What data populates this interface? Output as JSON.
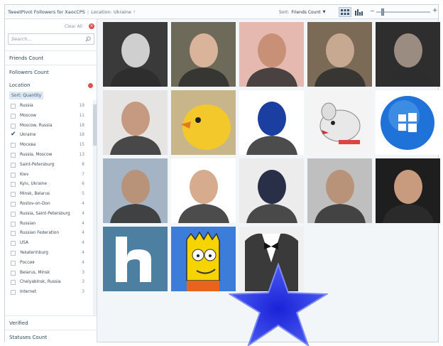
{
  "header": {
    "breadcrumb_app": "TweetPivot Followers for XaocCPS",
    "breadcrumb_location": "Location: Ukraine",
    "sort_label": "Sort:",
    "sort_value": "Friends Count",
    "zoom_minus": "−",
    "zoom_plus": "+"
  },
  "sidebar": {
    "clear_all": "Clear All",
    "search_placeholder": "Search...",
    "facets": {
      "friends_count": "Friends Count",
      "followers_count": "Followers Count",
      "location": "Location",
      "verified": "Verified",
      "statuses_count": "Statuses Count"
    },
    "location_sort": "Sort: Quantity",
    "locations": [
      {
        "label": "Russia",
        "count": "19",
        "checked": false
      },
      {
        "label": "Moscow",
        "count": "11",
        "checked": false
      },
      {
        "label": "Moscow, Russia",
        "count": "18",
        "checked": false
      },
      {
        "label": "Ukraine",
        "count": "18",
        "checked": true
      },
      {
        "label": "Москва",
        "count": "15",
        "checked": false
      },
      {
        "label": "Russia, Moscow",
        "count": "13",
        "checked": false
      },
      {
        "label": "Saint-Petersburg",
        "count": "8",
        "checked": false
      },
      {
        "label": "Kiev",
        "count": "7",
        "checked": false
      },
      {
        "label": "Kyiv, Ukraine",
        "count": "6",
        "checked": false
      },
      {
        "label": "Minsk, Belarus",
        "count": "5",
        "checked": false
      },
      {
        "label": "Rostov-on-Don",
        "count": "4",
        "checked": false
      },
      {
        "label": "Russia, Saint-Petersburg",
        "count": "4",
        "checked": false
      },
      {
        "label": "Russian",
        "count": "4",
        "checked": false
      },
      {
        "label": "Russian Federation",
        "count": "4",
        "checked": false
      },
      {
        "label": "USA",
        "count": "4",
        "checked": false
      },
      {
        "label": "Yekaterinburg",
        "count": "4",
        "checked": false
      },
      {
        "label": "Россия",
        "count": "4",
        "checked": false
      },
      {
        "label": "Belarus, Minsk",
        "count": "3",
        "checked": false
      },
      {
        "label": "Chelyabinsk, Russia",
        "count": "3",
        "checked": false
      },
      {
        "label": "Internet",
        "count": "3",
        "checked": false
      }
    ]
  },
  "avatars": [
    {
      "name": "gym-photo",
      "icon": "person"
    },
    {
      "name": "young-man",
      "icon": "person"
    },
    {
      "name": "man-pink-bg",
      "icon": "person"
    },
    {
      "name": "face-closeup",
      "icon": "person"
    },
    {
      "name": "bald-man-smoking",
      "icon": "person"
    },
    {
      "name": "man-short-hair",
      "icon": "person"
    },
    {
      "name": "yellow-chick",
      "icon": "bird"
    },
    {
      "name": "che-guevara",
      "icon": "person"
    },
    {
      "name": "cartoon-rat",
      "icon": "rat"
    },
    {
      "name": "windows-logo",
      "icon": "windows"
    },
    {
      "name": "man-sunglasses",
      "icon": "person"
    },
    {
      "name": "bald-man",
      "icon": "person"
    },
    {
      "name": "man-cap",
      "icon": "person"
    },
    {
      "name": "man-outdoors",
      "icon": "person"
    },
    {
      "name": "man-dark-bg",
      "icon": "person"
    },
    {
      "name": "letter-h",
      "icon": "h"
    },
    {
      "name": "bart-simpson",
      "icon": "bart"
    },
    {
      "name": "tuxedo",
      "icon": "tuxedo"
    }
  ],
  "colors": {
    "star": "#2b3fe0",
    "accent": "#2b4a63",
    "clear": "#e05050"
  }
}
